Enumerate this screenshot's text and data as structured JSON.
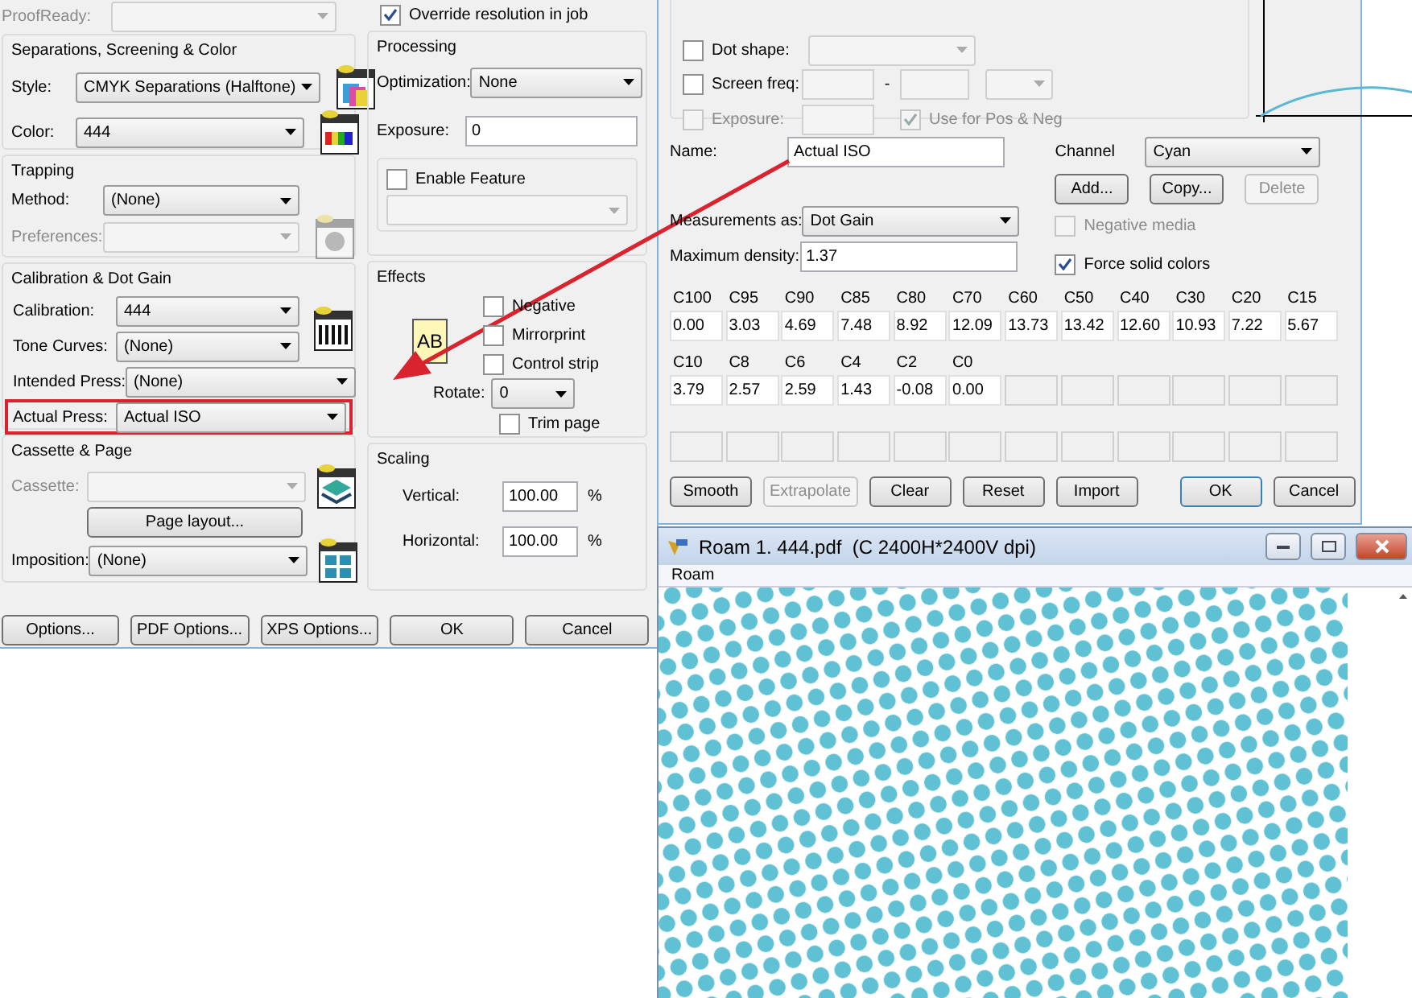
{
  "settings_dialog": {
    "proofready": {
      "label": "ProofReady:",
      "disabled": true
    },
    "separations": {
      "title": "Separations, Screening & Color",
      "style": {
        "label": "Style:",
        "value": "CMYK Separations (Halftone)"
      },
      "color": {
        "label": "Color:",
        "value": "444"
      }
    },
    "trapping": {
      "title": "Trapping",
      "method": {
        "label": "Method:",
        "value": "(None)"
      },
      "preferences": {
        "label": "Preferences:",
        "disabled": true
      }
    },
    "calibration": {
      "title": "Calibration & Dot Gain",
      "rows": [
        {
          "label": "Calibration:",
          "value": "444",
          "highlighted": false
        },
        {
          "label": "Tone Curves:",
          "value": "(None)",
          "highlighted": false
        },
        {
          "label": "Intended Press:",
          "value": "(None)",
          "highlighted": false
        },
        {
          "label": "Actual Press:",
          "value": "Actual ISO",
          "highlighted": true
        }
      ]
    },
    "cassette": {
      "title": "Cassette & Page",
      "cassette": {
        "label": "Cassette:",
        "disabled": true
      },
      "page_layout": "Page layout...",
      "imposition": {
        "label": "Imposition:",
        "value": "(None)"
      }
    },
    "override": {
      "label": "Override resolution in job",
      "checked": true
    },
    "processing": {
      "title": "Processing",
      "optimization": {
        "label": "Optimization:",
        "value": "None"
      },
      "exposure": {
        "label": "Exposure:",
        "value": "0"
      },
      "feature": {
        "label": "Enable Feature",
        "checked": false
      }
    },
    "effects": {
      "title": "Effects",
      "preview": "AB",
      "options": [
        {
          "label": "Negative",
          "checked": false
        },
        {
          "label": "Mirrorprint",
          "checked": false
        },
        {
          "label": "Control strip",
          "checked": false
        }
      ],
      "rotate": {
        "label": "Rotate:",
        "value": "0"
      },
      "trim": {
        "label": "Trim page",
        "checked": false
      }
    },
    "scaling": {
      "title": "Scaling",
      "rows": [
        {
          "label": "Vertical:",
          "value": "100.00",
          "unit": "%"
        },
        {
          "label": "Horizontal:",
          "value": "100.00",
          "unit": "%"
        }
      ]
    },
    "buttons": [
      {
        "label": "Options..."
      },
      {
        "label": "PDF Options..."
      },
      {
        "label": "XPS Options..."
      },
      {
        "label": "OK"
      },
      {
        "label": "Cancel"
      }
    ]
  },
  "press_dialog": {
    "screening": {
      "dot_shape": {
        "label": "Dot shape:",
        "checked": false
      },
      "screen_freq": {
        "label": "Screen freq:",
        "checked": false,
        "separator": "-"
      },
      "exposure": {
        "label": "Exposure:",
        "checked": false,
        "disabled": true
      },
      "pos_neg": {
        "label": "Use for Pos & Neg",
        "checked": true,
        "disabled": true
      }
    },
    "name": {
      "label": "Name:",
      "value": "Actual ISO"
    },
    "channel": {
      "label": "Channel",
      "value": "Cyan"
    },
    "channel_buttons": [
      {
        "label": "Add...",
        "disabled": false
      },
      {
        "label": "Copy...",
        "disabled": false
      },
      {
        "label": "Delete",
        "disabled": true
      }
    ],
    "measurements": {
      "label": "Measurements as:",
      "value": "Dot Gain"
    },
    "negative_media": {
      "label": "Negative media",
      "checked": false,
      "disabled": true
    },
    "max_density": {
      "label": "Maximum density:",
      "value": "1.37"
    },
    "force_solid": {
      "label": "Force solid colors",
      "checked": true
    },
    "points": [
      {
        "label": "C100",
        "value": "0.00"
      },
      {
        "label": "C95",
        "value": "3.03"
      },
      {
        "label": "C90",
        "value": "4.69"
      },
      {
        "label": "C85",
        "value": "7.48"
      },
      {
        "label": "C80",
        "value": "8.92"
      },
      {
        "label": "C70",
        "value": "12.09"
      },
      {
        "label": "C60",
        "value": "13.73"
      },
      {
        "label": "C50",
        "value": "13.42"
      },
      {
        "label": "C40",
        "value": "12.60"
      },
      {
        "label": "C30",
        "value": "10.93"
      },
      {
        "label": "C20",
        "value": "7.22"
      },
      {
        "label": "C15",
        "value": "5.67"
      },
      {
        "label": "C10",
        "value": "3.79"
      },
      {
        "label": "C8",
        "value": "2.57"
      },
      {
        "label": "C6",
        "value": "2.59"
      },
      {
        "label": "C4",
        "value": "1.43"
      },
      {
        "label": "C2",
        "value": "-0.08"
      },
      {
        "label": "C0",
        "value": "0.00"
      }
    ],
    "buttons": [
      {
        "label": "Smooth",
        "disabled": false,
        "default": false
      },
      {
        "label": "Extrapolate",
        "disabled": true,
        "default": false
      },
      {
        "label": "Clear",
        "disabled": false,
        "default": false
      },
      {
        "label": "Reset",
        "disabled": false,
        "default": false
      },
      {
        "label": "Import",
        "disabled": false,
        "default": false
      },
      {
        "label": "OK",
        "disabled": false,
        "default": true
      },
      {
        "label": "Cancel",
        "disabled": false,
        "default": false
      }
    ]
  },
  "roam_window": {
    "title": "Roam 1. 444.pdf  (C 2400H*2400V dpi)",
    "menu": [
      "Roam"
    ]
  }
}
